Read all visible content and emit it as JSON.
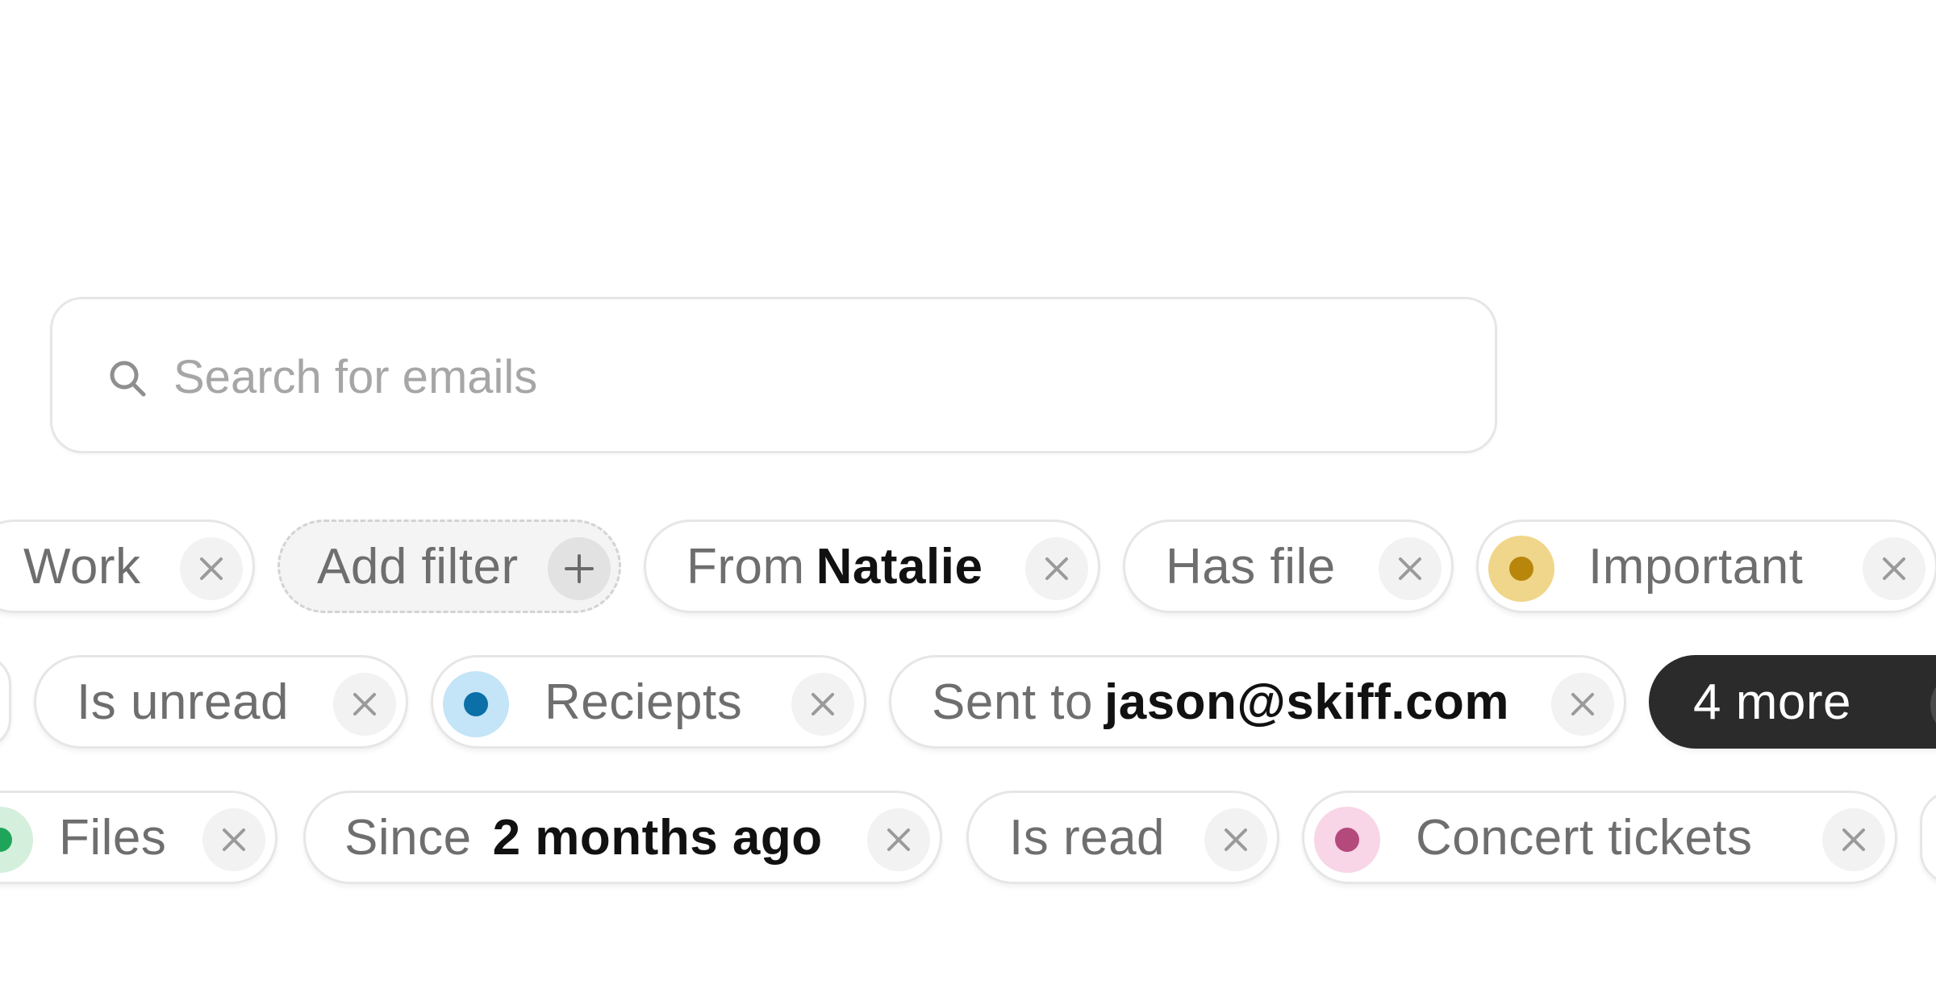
{
  "search": {
    "placeholder": "Search for emails"
  },
  "filters": {
    "row1": [
      {
        "label": "Work"
      },
      {
        "label": "Add filter"
      },
      {
        "label": "From",
        "value": "Natalie"
      },
      {
        "label": "Has file"
      },
      {
        "label": "Important",
        "dot_color": "#b8860b",
        "dot_bg": "#f0d68a"
      }
    ],
    "row2": [
      {
        "label": "Is unread"
      },
      {
        "label": "Reciepts",
        "dot_color": "#0b6fa8",
        "dot_bg": "#c4e4f7"
      },
      {
        "label": "Sent to",
        "value": "jason@skiff.com"
      },
      {
        "label": "4 more"
      }
    ],
    "row3": [
      {
        "label": "Files",
        "dot_color": "#1fa55a",
        "dot_bg": "#d4efdc"
      },
      {
        "label": "Since",
        "value": "2 months ago"
      },
      {
        "label": "Is read"
      },
      {
        "label": "Concert tickets",
        "dot_color": "#b44a7c",
        "dot_bg": "#f8d5e7"
      }
    ]
  },
  "icons": {
    "search": "search-icon",
    "remove": "close-icon",
    "add": "plus-icon",
    "expand": "chevron-down-icon"
  }
}
